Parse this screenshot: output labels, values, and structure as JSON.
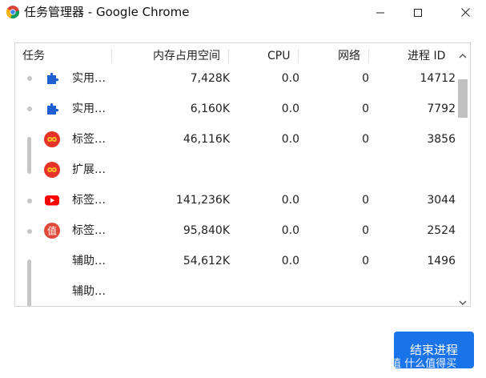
{
  "window": {
    "title": "任务管理器 - Google Chrome",
    "app_icon": "chrome-icon",
    "controls": [
      "minimize-icon",
      "maximize-icon",
      "close-icon"
    ]
  },
  "table": {
    "columns": [
      "任务",
      "内存占用空间",
      "CPU",
      "网络",
      "进程 ID"
    ],
    "rows": [
      {
        "icon": "puzzle-extension-icon",
        "task": "实用…",
        "memory": "7,428K",
        "cpu": "0.0",
        "network": "0",
        "pid": "14712"
      },
      {
        "icon": "puzzle-extension-icon",
        "task": "实用…",
        "memory": "6,160K",
        "cpu": "0.0",
        "network": "0",
        "pid": "7792"
      },
      {
        "icon": "infinity-red-icon",
        "task": "标签…",
        "memory": "46,116K",
        "cpu": "0.0",
        "network": "0",
        "pid": "3856"
      },
      {
        "icon": "infinity-red-icon",
        "task": "扩展…",
        "memory": "",
        "cpu": "",
        "network": "",
        "pid": ""
      },
      {
        "icon": "youtube-icon",
        "task": "标签…",
        "memory": "141,236K",
        "cpu": "0.0",
        "network": "0",
        "pid": "3044"
      },
      {
        "icon": "zhi-red-icon",
        "task": "标签…",
        "memory": "95,840K",
        "cpu": "0.0",
        "network": "0",
        "pid": "2524"
      },
      {
        "icon": "",
        "task": "辅助…",
        "memory": "54,612K",
        "cpu": "0.0",
        "network": "0",
        "pid": "1496"
      },
      {
        "icon": "",
        "task": "辅助…",
        "memory": "",
        "cpu": "",
        "network": "",
        "pid": ""
      }
    ]
  },
  "actions": {
    "end_process_label": "结束进程"
  },
  "watermark": {
    "text": "值 什么值得买"
  },
  "colors": {
    "accent": "#1a73e8",
    "bullet": "#c6c6c6",
    "border": "#d6d6d6"
  }
}
